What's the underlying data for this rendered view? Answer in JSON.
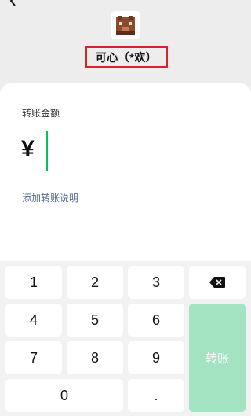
{
  "header": {
    "back_icon": "chevron-left-icon",
    "payee_name": "可心（*欢）"
  },
  "card": {
    "amount_label": "转账金额",
    "currency_symbol": "¥",
    "amount_value": "",
    "note_link": "添加转账说明"
  },
  "keypad": {
    "keys": [
      "1",
      "2",
      "3",
      "4",
      "5",
      "6",
      "7",
      "8",
      "9",
      "0",
      "."
    ],
    "backspace_icon": "backspace-icon",
    "transfer_label": "转账"
  },
  "colors": {
    "accent_green": "#07c160",
    "transfer_disabled": "#a4e3c2",
    "highlight_border": "#d4262a",
    "link_blue": "#576b95"
  }
}
